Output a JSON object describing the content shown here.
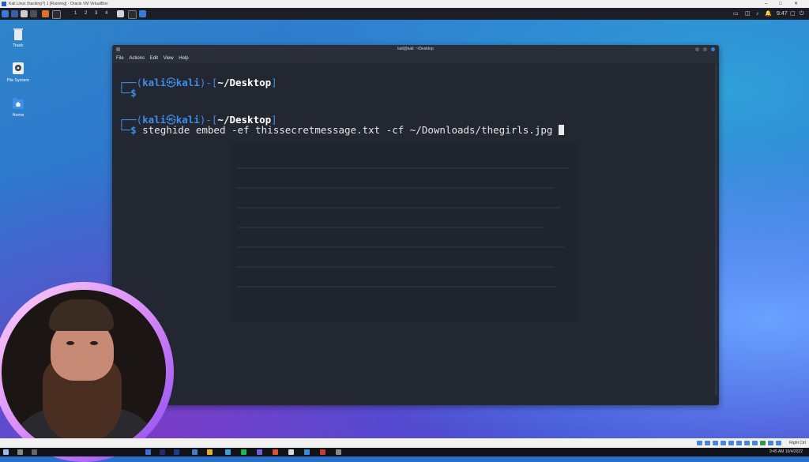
{
  "vm_window": {
    "title": "Kali Linux (hacking?) 1 [Running] - Oracle VM VirtualBox",
    "controls": [
      "–",
      "□",
      "✕"
    ]
  },
  "kali_panel": {
    "workspaces": [
      "1",
      "2",
      "3",
      "4"
    ],
    "time": "9:47",
    "icons": [
      "kali-menu-icon",
      "files-icon",
      "folder-icon",
      "firefox-icon",
      "terminal-icon",
      "vm-icon"
    ],
    "tray_icons": [
      "display-icon",
      "notification-icon",
      "sound-icon",
      "battery-icon",
      "network-icon",
      "lock-icon",
      "power-icon"
    ]
  },
  "desktop_icons": [
    {
      "label": "Trash",
      "icon": "trash-icon"
    },
    {
      "label": "File System",
      "icon": "drive-icon"
    },
    {
      "label": "Home",
      "icon": "home-folder-icon"
    }
  ],
  "terminal": {
    "title": "kali@kali: ~/Desktop",
    "menu": [
      "File",
      "Actions",
      "Edit",
      "View",
      "Help"
    ],
    "prompt_user": "kali",
    "prompt_host": "kali",
    "prompt_path": "~/Desktop",
    "lines": [
      {
        "type": "prompt"
      },
      {
        "type": "command",
        "text": ""
      },
      {
        "type": "prompt"
      },
      {
        "type": "command",
        "text": "steghide embed -ef thissecretmessage.txt -cf ~/Downloads/thegirls.jpg "
      }
    ]
  },
  "vm_status": {
    "host_key": "Right Ctrl"
  },
  "taskbar": {
    "time": "9:45 AM",
    "date": "10/4/2022"
  },
  "colors": {
    "prompt_blue": "#3d8ee8",
    "terminal_bg": "#232731",
    "accent": "#3d7be0"
  }
}
